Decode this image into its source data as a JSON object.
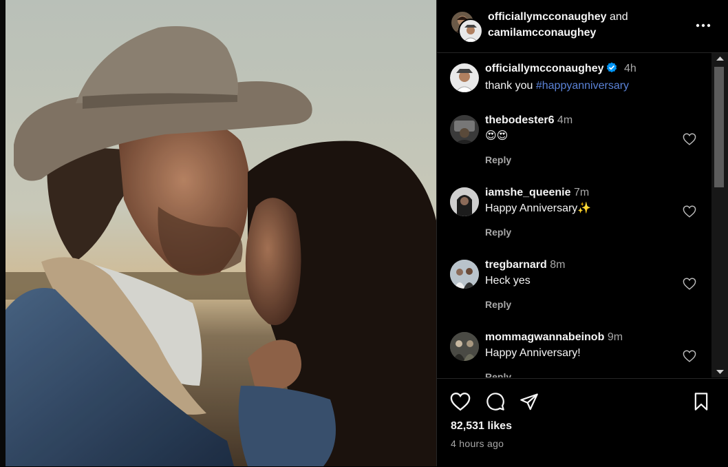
{
  "post": {
    "author": "officiallymcconaughey",
    "joiner": "and",
    "coauthor": "camilamcconaughey",
    "caption_author": "officiallymcconaughey",
    "caption_time": "4h",
    "caption_text": "thank you",
    "caption_hashtag": "#happyanniversary",
    "likes": "82,531 likes",
    "posted_ago": "4 hours ago",
    "photo_icon": "couple-photo"
  },
  "comments": [
    {
      "user": "thebodester6",
      "time": "4m",
      "text": "😍😍",
      "reply": "Reply"
    },
    {
      "user": "iamshe_queenie",
      "time": "7m",
      "text": "Happy Anniversary✨",
      "reply": "Reply"
    },
    {
      "user": "tregbarnard",
      "time": "8m",
      "text": "Heck yes",
      "reply": "Reply"
    },
    {
      "user": "mommagwannabeinob",
      "time": "9m",
      "text": "Happy Anniversary!",
      "reply": "Reply"
    }
  ],
  "icons": {
    "more": "more-options-icon",
    "like": "heart-icon",
    "comment": "comment-icon",
    "share": "share-icon",
    "save": "bookmark-icon",
    "verified": "verified-badge-icon"
  },
  "colors": {
    "background": "#000000",
    "hashtag": "#5b83d8",
    "verified": "#0095f6",
    "secondary_text": "#a8a8a8"
  }
}
